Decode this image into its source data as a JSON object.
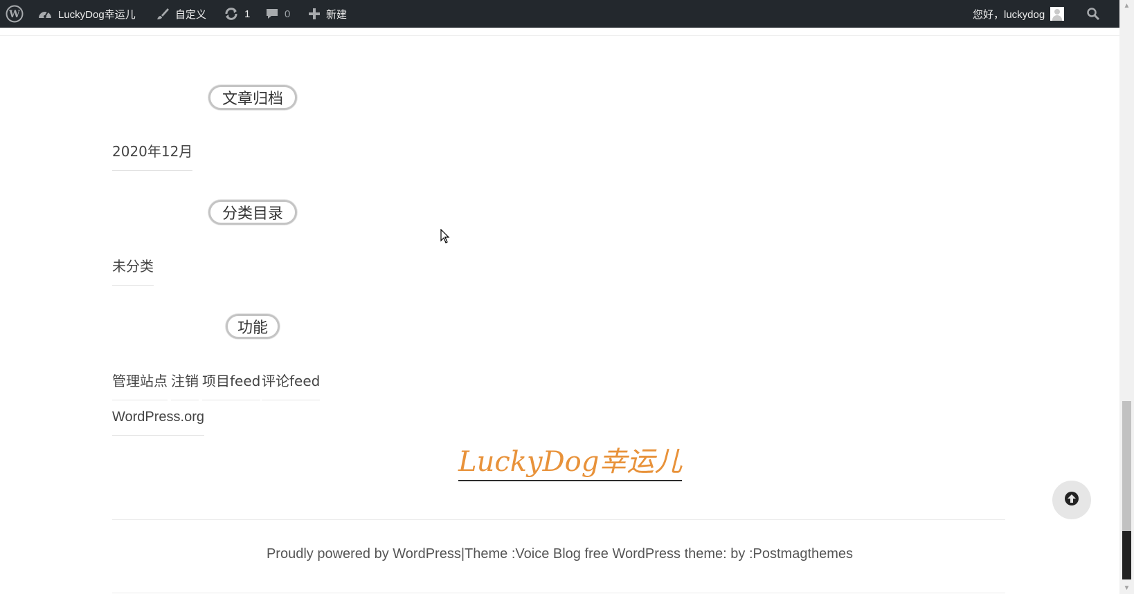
{
  "adminbar": {
    "site_name": "LuckyDog幸运儿",
    "customize": "自定义",
    "updates_count": "1",
    "comments_count": "0",
    "new_label": "新建",
    "greeting": "您好，luckydog"
  },
  "widgets": {
    "archives": {
      "title": "文章归档",
      "items": [
        "2020年12月"
      ]
    },
    "categories": {
      "title": "分类目录",
      "items": [
        "未分类"
      ]
    },
    "meta": {
      "title": "功能",
      "items": [
        "管理站点",
        "注销",
        "项目feed",
        "评论feed",
        "WordPress.org"
      ]
    }
  },
  "footer": {
    "site_title": "LuckyDog幸运儿",
    "credit": "Proudly powered by WordPress|Theme :Voice Blog free WordPress theme: by :Postmagthemes"
  },
  "colors": {
    "adminbar_bg": "#23282d",
    "site_title": "#e8923a"
  }
}
